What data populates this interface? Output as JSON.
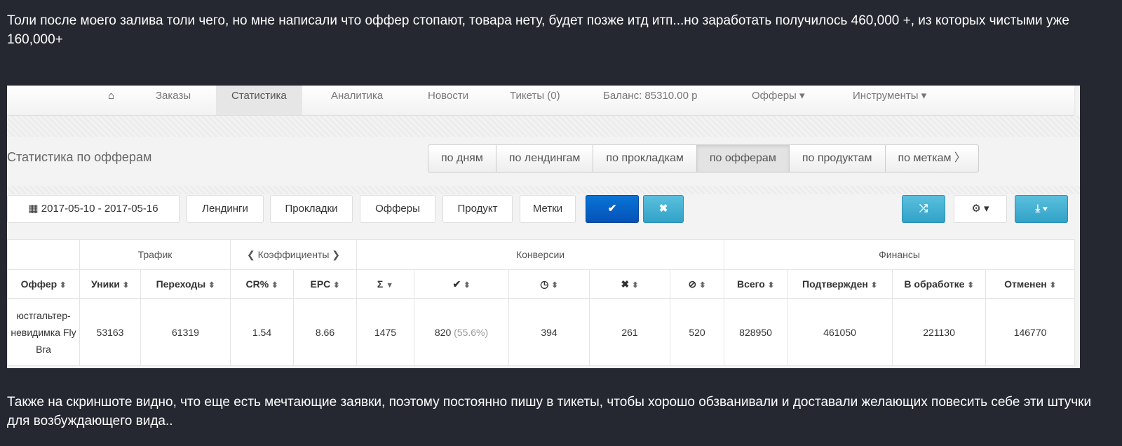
{
  "post": {
    "intro": "Толи после моего залива толи чего, но мне написали что оффер стопают, товара нету, будет позже итд итп...но заработать получилось 460,000 +, из которых чистыми уже 160,000+",
    "outro": "Также на скриншоте видно, что еще есть мечтающие заявки, поэтому постоянно пишу в тикеты, чтобы хорошо обзванивали и доставали желающих повесить себе эти штучки для возбуждающего вида.."
  },
  "nav": {
    "home_icon": "home-icon",
    "items": [
      "Заказы",
      "Статистика",
      "Аналитика",
      "Новости",
      "Тикеты (0)",
      "Баланс: 85310.00 р",
      "Офферы ▾",
      "Инструменты ▾"
    ]
  },
  "panel": {
    "title": "Статистика по офферам",
    "tabs": [
      "по дням",
      "по лендингам",
      "по прокладкам",
      "по офферам",
      "по продуктам",
      "по меткам 〉"
    ],
    "active_tab": "по офферам"
  },
  "toolbar": {
    "date_range": "2017-05-10 - 2017-05-16",
    "filters": [
      "Лендинги",
      "Прокладки",
      "Офферы",
      "Продукт",
      "Метки"
    ],
    "apply": "✔",
    "reset": "✖",
    "shuffle": "⤮",
    "settings": "⚙ ▾",
    "export": "⤓ ▾"
  },
  "table": {
    "groups": [
      "",
      "Трафик",
      "❮ Коэффициенты ❯",
      "Конверсии",
      "Финансы"
    ],
    "columns": [
      "Оффер",
      "Уники",
      "Переходы",
      "CR%",
      "EPC",
      "Σ",
      "✔",
      "◷",
      "✖",
      "⊘",
      "Всего",
      "Подтвержден",
      "В обработке",
      "Отменен"
    ],
    "row": {
      "offer": "юстгальтер-невидимка Fly Bra",
      "uniques": "53163",
      "clicks": "61319",
      "cr": "1.54",
      "epc": "8.66",
      "total": "1475",
      "approved": "820",
      "approved_pct": "(55.6%)",
      "pending": "394",
      "rejected": "261",
      "trash": "520",
      "fin_total": "828950",
      "fin_approved": "461050",
      "fin_pending": "221130",
      "fin_cancelled": "146770"
    }
  }
}
